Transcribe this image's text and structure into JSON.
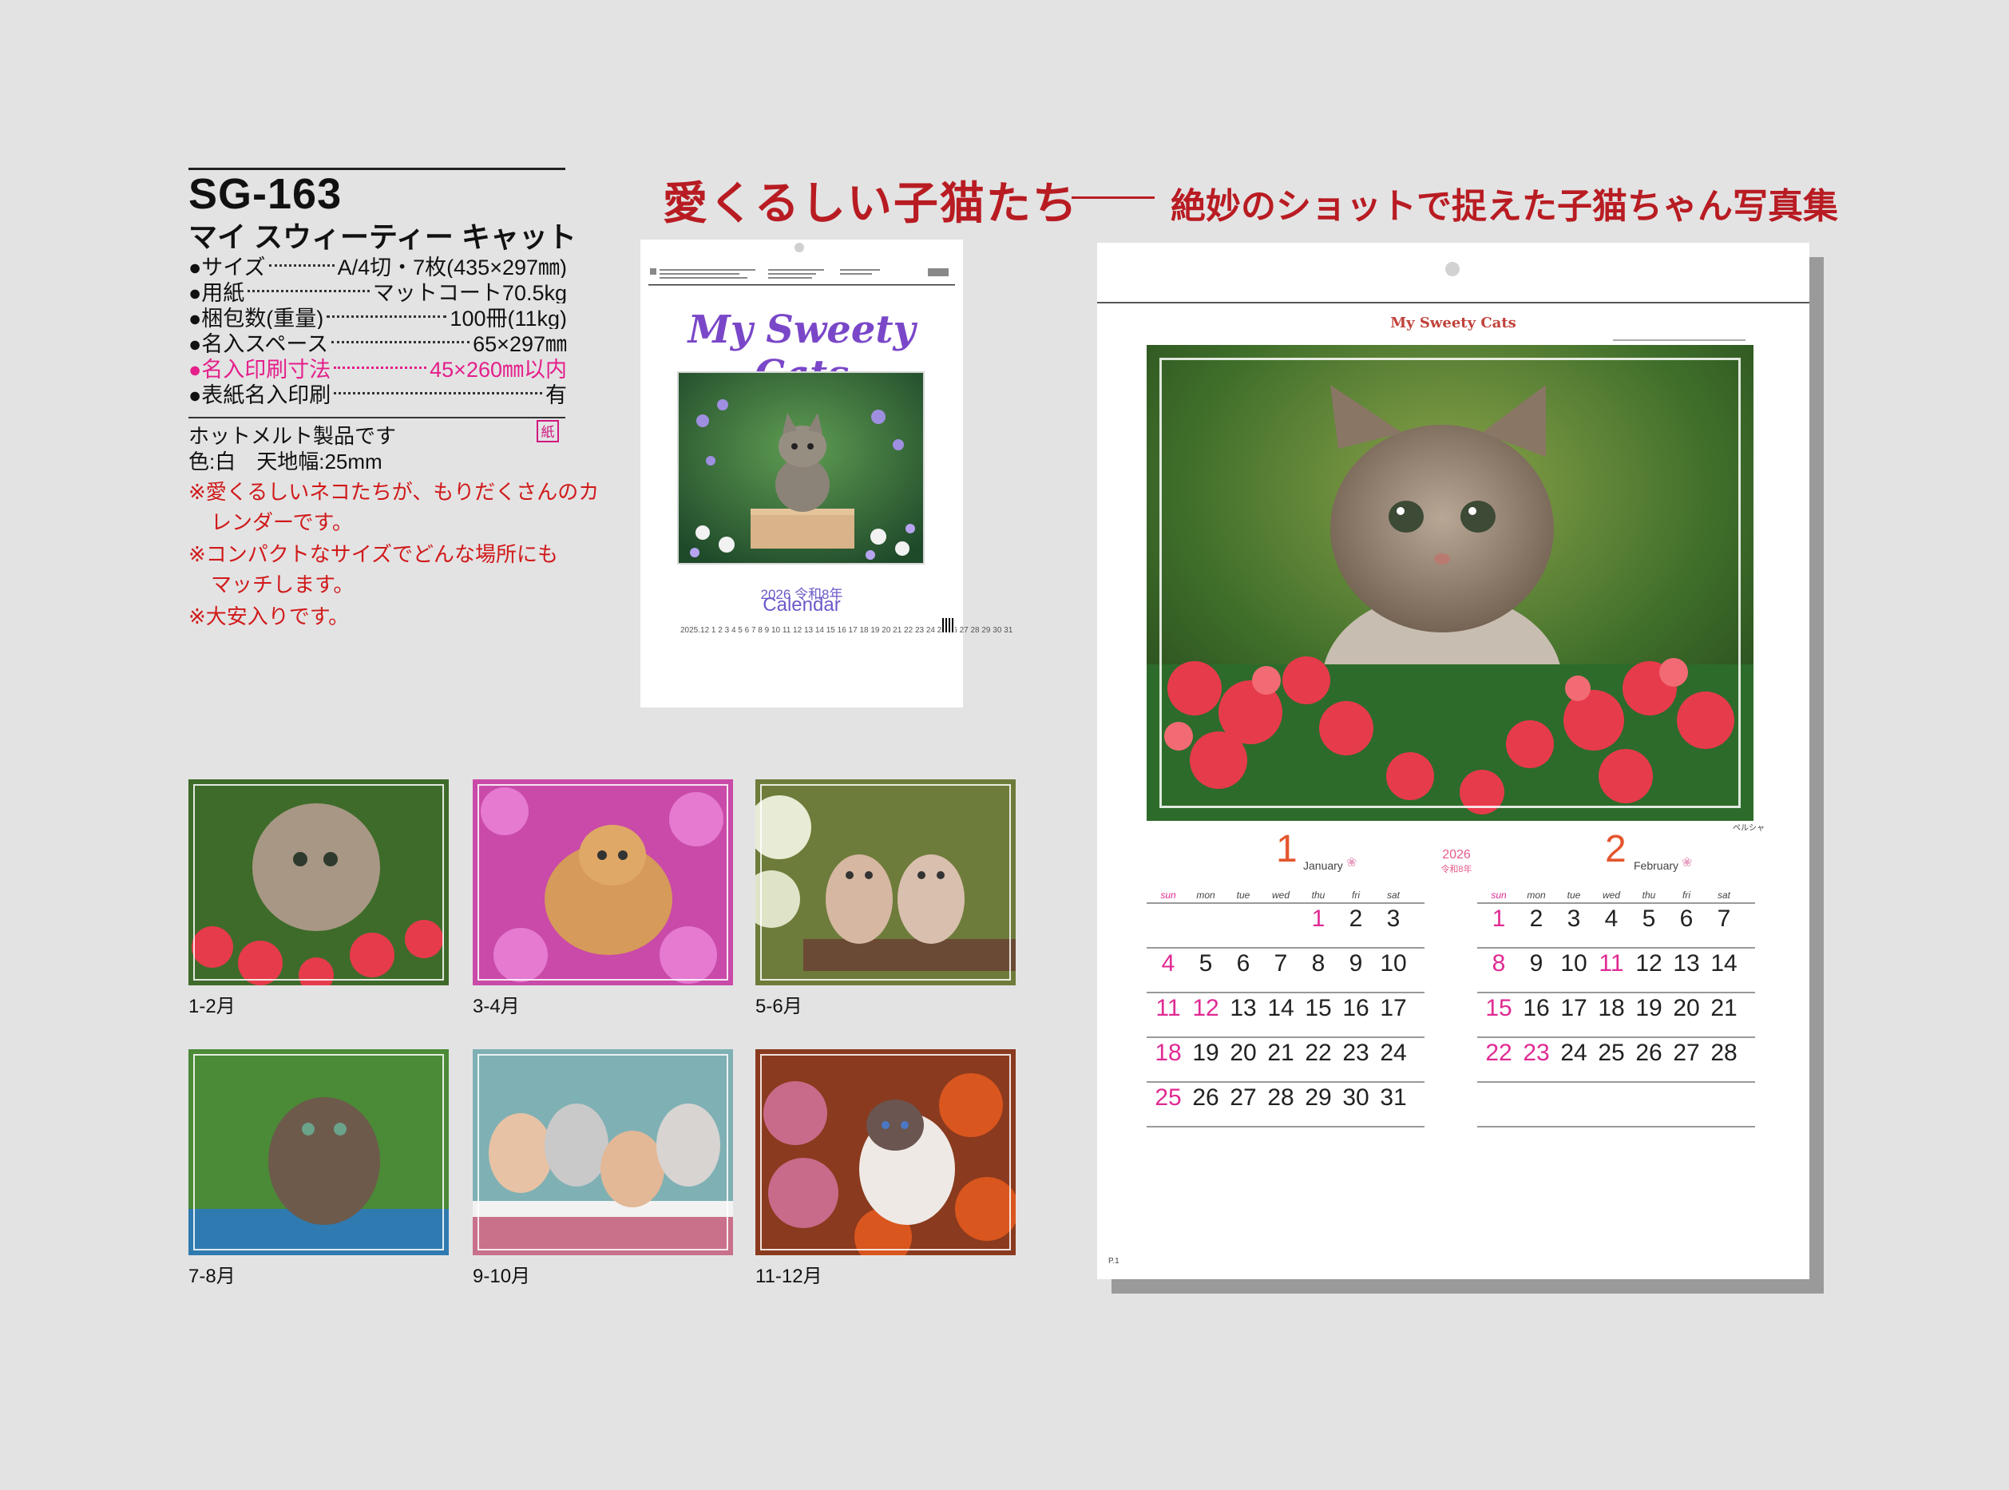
{
  "product": {
    "code": "SG-163",
    "name": "マイ スウィーティー キャット"
  },
  "specs": [
    {
      "label": "●サイズ",
      "value": "A/4切・7枚(435×297㎜)"
    },
    {
      "label": "●用紙",
      "value": "マットコート70.5kg"
    },
    {
      "label": "●梱包数(重量)",
      "value": "100冊(11kg)"
    },
    {
      "label": "●名入スペース",
      "value": "65×297㎜"
    },
    {
      "label": "●名入印刷寸法",
      "value": "45×260㎜以内"
    },
    {
      "label": "●表紙名入印刷",
      "value": "有"
    }
  ],
  "paper_badge": "紙",
  "notes": {
    "hotmelt": "ホットメルト製品です",
    "color": "色:白　天地幅:25mm",
    "n1a": "※愛くるしいネコたちが、もりだくさんのカ",
    "n1b": "レンダーです。",
    "n2a": "※コンパクトなサイズでどんな場所にも",
    "n2b": "マッチします。",
    "n3": "※大安入りです。"
  },
  "headline": {
    "main": "愛くるしい子猫たち",
    "sub": "絶妙のショットで捉えた子猫ちゃん写真集"
  },
  "cover": {
    "title": "My Sweety Cats",
    "year_line": "2026 令和8年",
    "calendar_word": "Calendar",
    "days_row": "2025.12   1 2 3 4 5 6 7 8 9 10 11 12 13 14 15 16 17 18 19 20 21 22 23 24 25 26 27 28 29 30 31"
  },
  "big_calendar": {
    "title": "My Sweety Cats",
    "photo_caption": "ペルシャ",
    "page": "P.1",
    "year": "2026",
    "era": "令和8年",
    "weekdays": [
      "sun",
      "mon",
      "tue",
      "wed",
      "thu",
      "fri",
      "sat"
    ],
    "months": [
      {
        "num": "1",
        "name": "January",
        "rows": [
          [
            "",
            "",
            "",
            "",
            "1",
            "2",
            "3"
          ],
          [
            "4",
            "5",
            "6",
            "7",
            "8",
            "9",
            "10"
          ],
          [
            "11",
            "12",
            "13",
            "14",
            "15",
            "16",
            "17"
          ],
          [
            "18",
            "19",
            "20",
            "21",
            "22",
            "23",
            "24"
          ],
          [
            "25",
            "26",
            "27",
            "28",
            "29",
            "30",
            "31"
          ]
        ],
        "holidays": [
          "1",
          "12"
        ]
      },
      {
        "num": "2",
        "name": "February",
        "rows": [
          [
            "1",
            "2",
            "3",
            "4",
            "5",
            "6",
            "7"
          ],
          [
            "8",
            "9",
            "10",
            "11",
            "12",
            "13",
            "14"
          ],
          [
            "15",
            "16",
            "17",
            "18",
            "19",
            "20",
            "21"
          ],
          [
            "22",
            "23",
            "24",
            "25",
            "26",
            "27",
            "28"
          ]
        ],
        "holidays": [
          "11",
          "23"
        ]
      }
    ]
  },
  "thumbs": [
    {
      "label": "1-2月"
    },
    {
      "label": "3-4月"
    },
    {
      "label": "5-6月"
    },
    {
      "label": "7-8月"
    },
    {
      "label": "9-10月"
    },
    {
      "label": "11-12月"
    }
  ],
  "colors": {
    "headline": "#b81c22",
    "magenta": "#e41f8a",
    "holiday": "#e02a93",
    "month_number": "#e4562e",
    "cover_title": "#7a47c8"
  }
}
